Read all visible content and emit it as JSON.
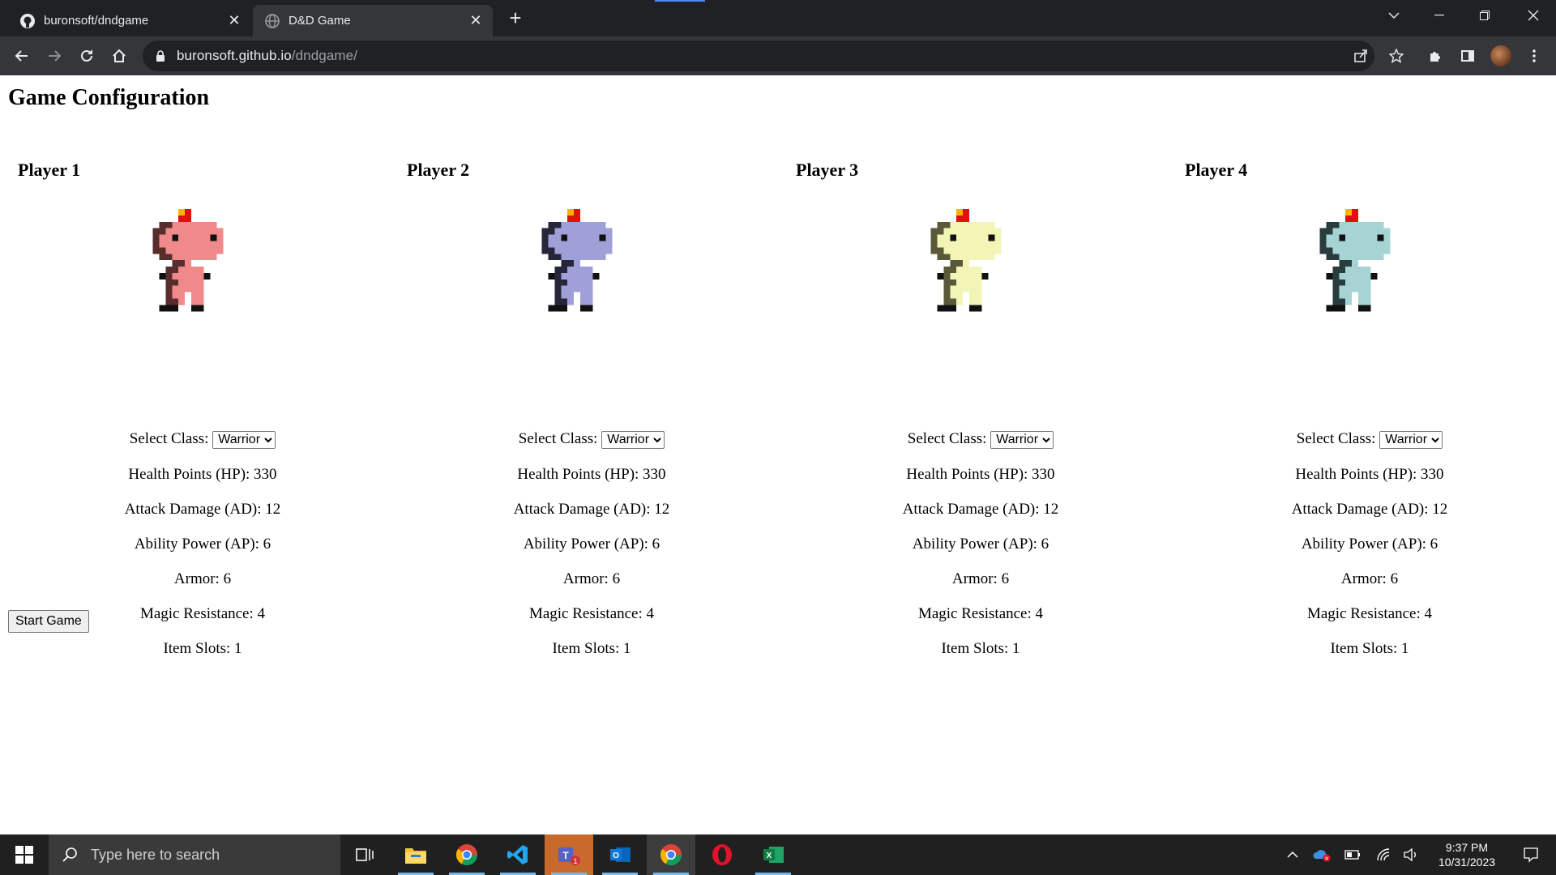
{
  "browser": {
    "tabs": [
      {
        "title": "buronsoft/dndgame",
        "favicon": "github-icon",
        "active": false
      },
      {
        "title": "D&D Game",
        "favicon": "globe-icon",
        "active": true
      }
    ],
    "url": {
      "host": "buronsoft.github.io",
      "path": "/dndgame/"
    }
  },
  "page": {
    "heading": "Game Configuration",
    "players": [
      {
        "name": "Player 1",
        "color": "#f08a8a",
        "shade": "#5a2d2d",
        "select_label": "Select Class:",
        "class": "Warrior",
        "hp": "Health Points (HP): 330",
        "ad": "Attack Damage (AD): 12",
        "ap": "Ability Power (AP): 6",
        "armor": "Armor: 6",
        "mr": "Magic Resistance: 4",
        "slots": "Item Slots: 1"
      },
      {
        "name": "Player 2",
        "color": "#a0a0d8",
        "shade": "#26263a",
        "select_label": "Select Class:",
        "class": "Warrior",
        "hp": "Health Points (HP): 330",
        "ad": "Attack Damage (AD): 12",
        "ap": "Ability Power (AP): 6",
        "armor": "Armor: 6",
        "mr": "Magic Resistance: 4",
        "slots": "Item Slots: 1"
      },
      {
        "name": "Player 3",
        "color": "#f2f5b6",
        "shade": "#5a5a3a",
        "select_label": "Select Class:",
        "class": "Warrior",
        "hp": "Health Points (HP): 330",
        "ad": "Attack Damage (AD): 12",
        "ap": "Ability Power (AP): 6",
        "armor": "Armor: 6",
        "mr": "Magic Resistance: 4",
        "slots": "Item Slots: 1"
      },
      {
        "name": "Player 4",
        "color": "#a6d4d4",
        "shade": "#2a3d3d",
        "select_label": "Select Class:",
        "class": "Warrior",
        "hp": "Health Points (HP): 330",
        "ad": "Attack Damage (AD): 12",
        "ap": "Ability Power (AP): 6",
        "armor": "Armor: 6",
        "mr": "Magic Resistance: 4",
        "slots": "Item Slots: 1"
      }
    ],
    "start_button": "Start Game"
  },
  "taskbar": {
    "search_placeholder": "Type here to search",
    "time": "9:37 PM",
    "date": "10/31/2023",
    "apps": [
      "task-view-icon",
      "file-explorer-icon",
      "chrome-icon",
      "vscode-icon",
      "teams-icon",
      "outlook-icon",
      "chrome-icon",
      "opera-icon",
      "excel-icon"
    ]
  }
}
